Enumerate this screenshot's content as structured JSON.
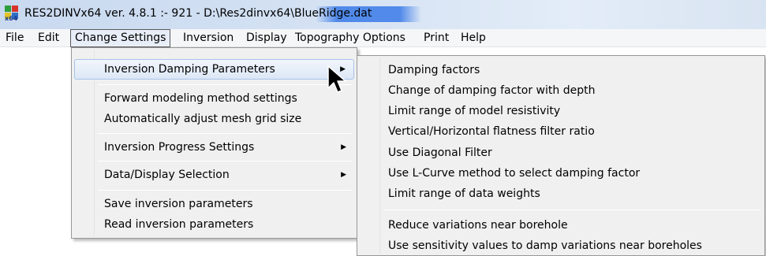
{
  "window": {
    "title": "RES2DINVx64 ver. 4.8.1 :- 921 - D:\\Res2dinvx64\\BlueRidge.dat",
    "app_icon": "res2dinv-x64-icon",
    "app_icon_text": "x64"
  },
  "menubar": {
    "items": [
      {
        "label": "File"
      },
      {
        "label": "Edit"
      },
      {
        "label": "Change Settings",
        "active": true
      },
      {
        "label": "Inversion"
      },
      {
        "label": "Display"
      },
      {
        "label": "Topography Options"
      },
      {
        "label": "Print"
      },
      {
        "label": "Help"
      }
    ]
  },
  "change_settings_menu": {
    "items": [
      {
        "label": "Inversion Damping Parameters",
        "submenu": true,
        "highlighted": true
      },
      {
        "label": "Forward modeling method settings"
      },
      {
        "label": "Automatically adjust mesh grid size"
      },
      {
        "label": "Inversion Progress Settings",
        "submenu": true
      },
      {
        "label": "Data/Display Selection",
        "submenu": true
      },
      {
        "label": "Save inversion parameters"
      },
      {
        "label": "Read inversion parameters"
      }
    ]
  },
  "damping_submenu": {
    "items": [
      {
        "label": "Damping factors"
      },
      {
        "label": "Change of damping factor with depth"
      },
      {
        "label": "Limit range of model resistivity"
      },
      {
        "label": "Vertical/Horizontal flatness filter ratio"
      },
      {
        "label": "Use Diagonal Filter"
      },
      {
        "label": "Use L-Curve method to select damping factor"
      },
      {
        "label": "Limit range of data weights"
      },
      {
        "label": "Reduce variations near borehole"
      },
      {
        "label": "Use sensitivity values to damp variations near boreholes"
      }
    ]
  },
  "icons": {
    "submenu_arrow": "chevron-right-icon",
    "cursor": "mouse-pointer-icon"
  },
  "colors": {
    "menu_bg": "#f0f0f0",
    "hover_border": "#a8c3e8",
    "title_gradient": "#c9d9ef"
  }
}
